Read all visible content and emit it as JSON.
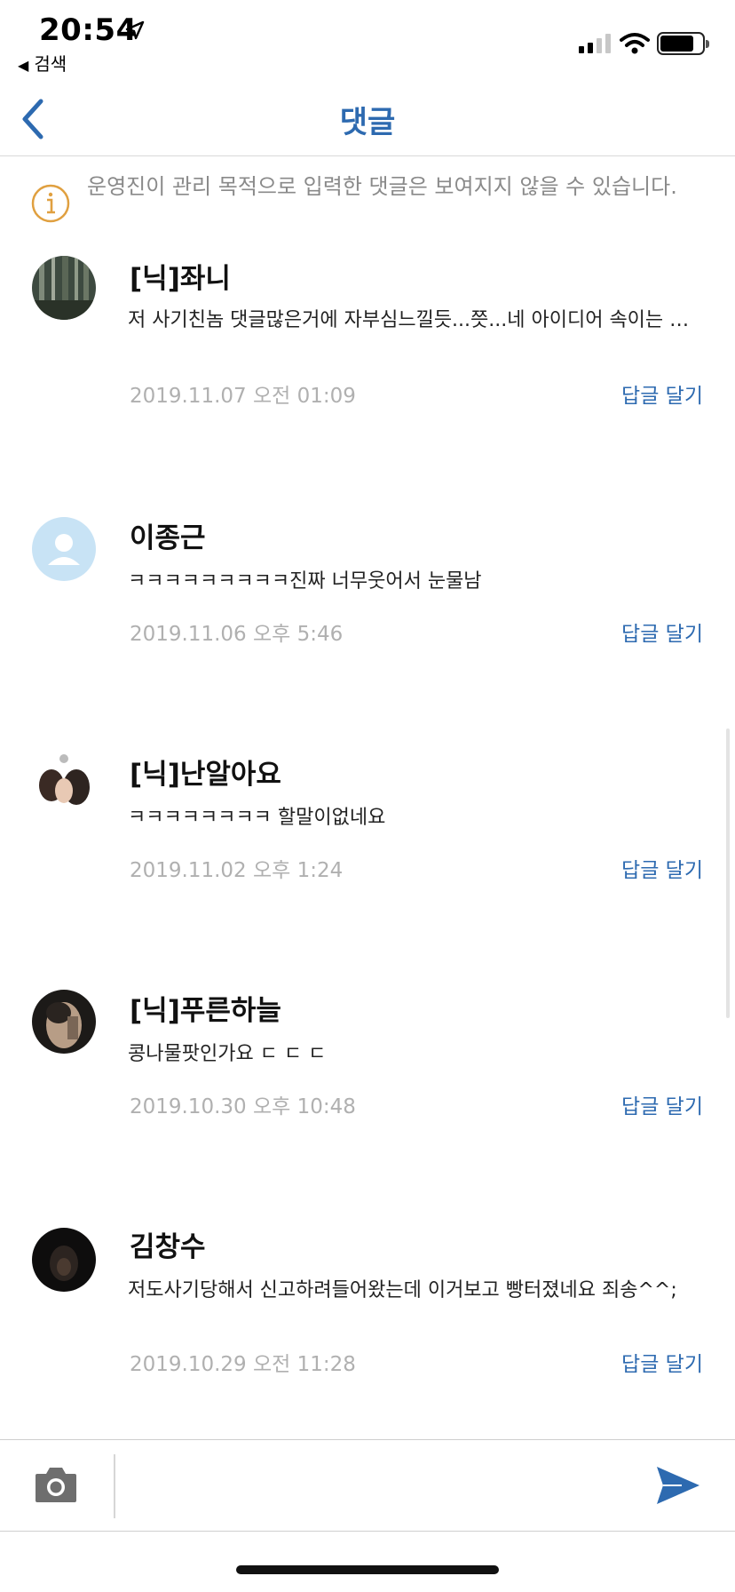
{
  "status_bar": {
    "time": "20:54",
    "back_app_label": "검색"
  },
  "nav": {
    "title": "댓글",
    "accent_color": "#2d6ab0"
  },
  "notice": {
    "icon": "info-icon",
    "text": "운영진이 관리 목적으로 입력한 댓글은 보여지지 않을 수 있습니다."
  },
  "comments": [
    {
      "author": "[닉]좌니",
      "body": "저 사기친놈 댓글많은거에 자부심느낄듯...쯧...네 아이디어 속이는 놈들 다 잡아야함",
      "date": "2019.11.07 오전 01:09",
      "reply_label": "답글 달기"
    },
    {
      "author": "이종근",
      "body": "ㅋㅋㅋㅋㅋㅋㅋㅋㅋ진짜 너무웃어서 눈물남",
      "date": "2019.11.06 오후 5:46",
      "reply_label": "답글 달기"
    },
    {
      "author": "[닉]난알아요",
      "body": "ㅋㅋㅋㅋㅋㅋㅋㅋ 할말이없네요",
      "date": "2019.11.02 오후 1:24",
      "reply_label": "답글 달기"
    },
    {
      "author": "[닉]푸른하늘",
      "body": "콩나물팟인가요 ㄷ ㄷ ㄷ",
      "date": "2019.10.30 오후 10:48",
      "reply_label": "답글 달기"
    },
    {
      "author": "김창수",
      "body": "저도사기당해서 신고하려들어왔는데 이거보고 빵터졌네요 죄송^^;",
      "date": "2019.10.29 오전 11:28",
      "reply_label": "답글 달기"
    }
  ],
  "input_bar": {
    "placeholder": "",
    "camera_icon": "camera-icon",
    "send_icon": "send-icon"
  }
}
